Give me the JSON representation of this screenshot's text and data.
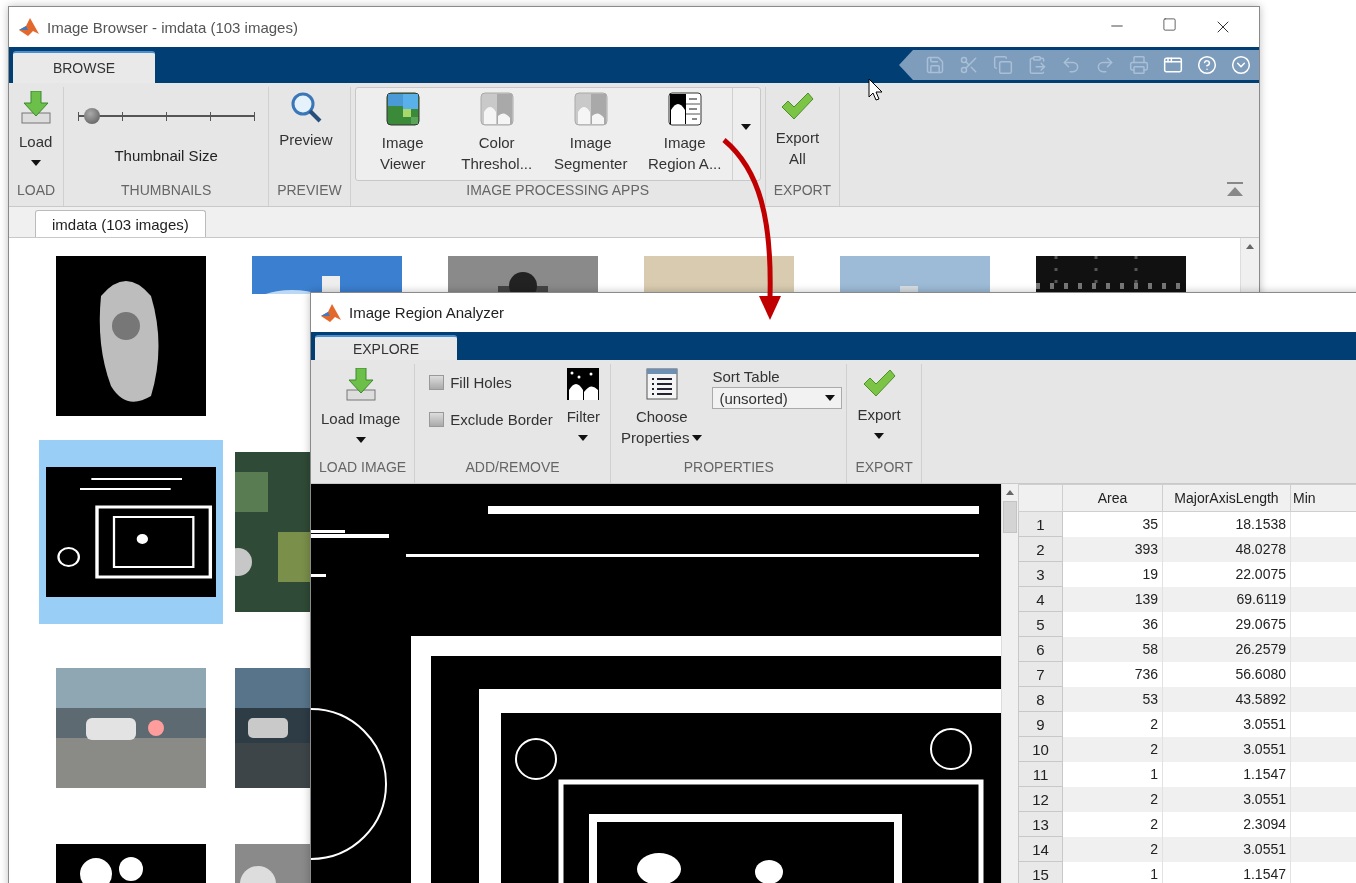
{
  "browser": {
    "title": "Image Browser - imdata (103 images)",
    "tabs": [
      {
        "label": "BROWSE",
        "selected": true
      }
    ],
    "quick_access": [
      {
        "disabled": true
      },
      {
        "disabled": true
      },
      {
        "disabled": true
      },
      {
        "disabled": true
      },
      {
        "disabled": true
      },
      {
        "disabled": true
      },
      {
        "disabled": true
      },
      {
        "disabled": false
      },
      {
        "disabled": false
      },
      {
        "disabled": false
      }
    ],
    "ribbon": [
      {
        "title": "LOAD",
        "items": [
          {
            "kind": "button",
            "lines": [
              "Load"
            ],
            "menu": true
          }
        ]
      },
      {
        "title": "THUMBNAILS",
        "items": [
          {
            "kind": "slider",
            "label": "Thumbnail Size",
            "level": 0.08
          }
        ]
      },
      {
        "title": "PREVIEW",
        "items": [
          {
            "kind": "button",
            "lines": [
              "Preview"
            ],
            "menu": false
          }
        ]
      },
      {
        "title": "IMAGE PROCESSING APPS",
        "items": [
          {
            "kind": "gallery",
            "more": true,
            "apps": [
              {
                "lines": [
                  "Image",
                  "Viewer"
                ]
              },
              {
                "lines": [
                  "Color",
                  "Threshol..."
                ]
              },
              {
                "lines": [
                  "Image",
                  "Segmenter"
                ]
              },
              {
                "lines": [
                  "Image",
                  "Region A..."
                ]
              }
            ]
          }
        ]
      },
      {
        "title": "EXPORT",
        "items": [
          {
            "kind": "button",
            "lines": [
              "Export",
              "All"
            ],
            "menu": false
          }
        ]
      }
    ],
    "document_tabs": [
      {
        "label": "imdata (103 images)",
        "selected": true
      }
    ],
    "thumbnail_rows": [
      [
        {
          "selected": false
        },
        {
          "selected": false
        },
        {
          "selected": false
        },
        {
          "selected": false
        },
        {
          "selected": false
        },
        {
          "selected": false
        }
      ],
      [
        {
          "selected": true
        },
        {
          "selected": false
        }
      ],
      [
        {
          "selected": false
        },
        {
          "selected": false
        }
      ],
      [
        {
          "selected": false
        },
        {
          "selected": false
        }
      ]
    ]
  },
  "analyzer": {
    "title": "Image Region Analyzer",
    "tabs": [
      {
        "label": "EXPLORE",
        "selected": true
      }
    ],
    "ribbon": [
      {
        "title": "LOAD IMAGE",
        "items": [
          {
            "kind": "button",
            "lines": [
              "Load Image"
            ],
            "menu": true
          }
        ]
      },
      {
        "title": "ADD/REMOVE",
        "items": [
          {
            "kind": "checkbox",
            "label": "Fill Holes",
            "checked": false
          },
          {
            "kind": "checkbox",
            "label": "Exclude Border",
            "checked": false
          },
          {
            "kind": "button",
            "lines": [
              "Filter"
            ],
            "menu": true
          }
        ]
      },
      {
        "title": "PROPERTIES",
        "items": [
          {
            "kind": "button",
            "lines": [
              "Choose",
              "Properties"
            ],
            "menu": true
          },
          {
            "kind": "select",
            "label": "Sort Table",
            "value": "(unsorted)"
          }
        ]
      },
      {
        "title": "EXPORT",
        "items": [
          {
            "kind": "button",
            "lines": [
              "Export"
            ],
            "menu": true
          }
        ]
      }
    ],
    "table": {
      "columns": [
        "Area",
        "MajorAxisLength",
        "Min"
      ],
      "rows": [
        {
          "index": "1",
          "cells": [
            "35",
            "18.1538"
          ]
        },
        {
          "index": "2",
          "cells": [
            "393",
            "48.0278"
          ]
        },
        {
          "index": "3",
          "cells": [
            "19",
            "22.0075"
          ]
        },
        {
          "index": "4",
          "cells": [
            "139",
            "69.6119"
          ]
        },
        {
          "index": "5",
          "cells": [
            "36",
            "29.0675"
          ]
        },
        {
          "index": "6",
          "cells": [
            "58",
            "26.2579"
          ]
        },
        {
          "index": "7",
          "cells": [
            "736",
            "56.6080"
          ]
        },
        {
          "index": "8",
          "cells": [
            "53",
            "43.5892"
          ]
        },
        {
          "index": "9",
          "cells": [
            "2",
            "3.0551"
          ]
        },
        {
          "index": "10",
          "cells": [
            "2",
            "3.0551"
          ]
        },
        {
          "index": "11",
          "cells": [
            "1",
            "1.1547"
          ]
        },
        {
          "index": "12",
          "cells": [
            "2",
            "3.0551"
          ]
        },
        {
          "index": "13",
          "cells": [
            "2",
            "2.3094"
          ]
        },
        {
          "index": "14",
          "cells": [
            "2",
            "3.0551"
          ]
        },
        {
          "index": "15",
          "cells": [
            "1",
            "1.1547"
          ]
        }
      ]
    }
  }
}
